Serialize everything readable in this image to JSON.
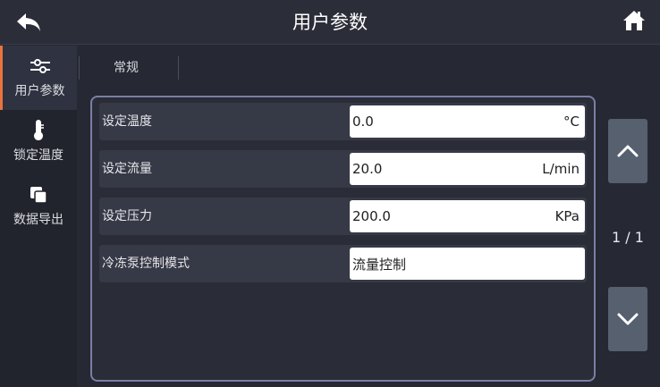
{
  "header": {
    "title": "用户参数"
  },
  "sidebar": {
    "items": [
      {
        "label": "用户参数",
        "icon": "sliders-icon",
        "active": true
      },
      {
        "label": "锁定温度",
        "icon": "thermometer-icon",
        "active": false
      },
      {
        "label": "数据导出",
        "icon": "copy-icon",
        "active": false
      }
    ]
  },
  "tabs": {
    "general": "常规"
  },
  "params": [
    {
      "label": "设定温度",
      "value": "0.0",
      "unit": "°C"
    },
    {
      "label": "设定流量",
      "value": "20.0",
      "unit": "L/min"
    },
    {
      "label": "设定压力",
      "value": "200.0",
      "unit": "KPa"
    },
    {
      "label": "冷冻泵控制模式",
      "value": "流量控制",
      "unit": ""
    }
  ],
  "pager": {
    "indicator": "1 / 1"
  },
  "colors": {
    "accent": "#e8743c",
    "panel_border": "#7a7fa6",
    "pager_button": "#56606f"
  }
}
